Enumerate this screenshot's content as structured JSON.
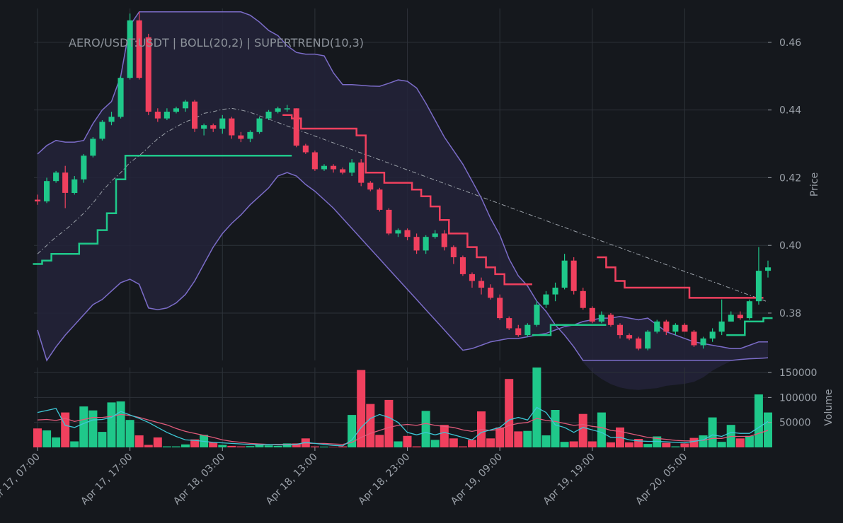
{
  "chart_data": {
    "type": "candlestick",
    "title": "AERO/USDT:USDT | BOLL(20,2) | SUPERTREND(10,3)",
    "price_axis": {
      "label": "Price",
      "ylim": [
        0.366,
        0.47
      ],
      "ticks": [
        0.38,
        0.4,
        0.42,
        0.44,
        0.46
      ],
      "tick_labels": [
        "0.38",
        "0.40",
        "0.42",
        "0.44",
        "0.46"
      ]
    },
    "volume_axis": {
      "label": "Volume",
      "ylim": [
        0,
        160000
      ],
      "ticks": [
        50000,
        100000,
        150000
      ],
      "tick_labels": [
        "50000",
        "100000",
        "150000"
      ]
    },
    "x_axis": {
      "interval_hours": 1,
      "n_bars": 80,
      "tick_indices": [
        0,
        10,
        20,
        30,
        40,
        50,
        60,
        70
      ],
      "tick_labels": [
        "Apr 17, 07:00",
        "Apr 17, 17:00",
        "Apr 18, 03:00",
        "Apr 18, 13:00",
        "Apr 18, 23:00",
        "Apr 19, 09:00",
        "Apr 19, 19:00",
        "Apr 20, 05:00"
      ]
    },
    "grid": true,
    "colors": {
      "up": "#1fc88a",
      "down": "#f0405e",
      "bollinger": "#7b6cc8",
      "bollinger_mid": "#9aa0a8",
      "volume_ma_fast": "#3dc8d6",
      "volume_ma_slow": "#e05a7a"
    },
    "candles": {
      "open": [
        0.4135,
        0.413,
        0.419,
        0.4215,
        0.4155,
        0.4195,
        0.4265,
        0.4315,
        0.4365,
        0.438,
        0.4495,
        0.4665,
        0.4615,
        0.4395,
        0.4375,
        0.4395,
        0.4405,
        0.4425,
        0.4345,
        0.4355,
        0.4345,
        0.4375,
        0.4325,
        0.4315,
        0.4335,
        0.4375,
        0.4395,
        0.4405,
        0.4405,
        0.4295,
        0.4275,
        0.4225,
        0.4235,
        0.4225,
        0.4215,
        0.4245,
        0.4185,
        0.4165,
        0.4105,
        0.4035,
        0.4045,
        0.4025,
        0.3985,
        0.4025,
        0.4035,
        0.3995,
        0.3965,
        0.3915,
        0.3895,
        0.3875,
        0.3845,
        0.3785,
        0.3755,
        0.3735,
        0.3765,
        0.3825,
        0.3855,
        0.3875,
        0.3955,
        0.3865,
        0.3815,
        0.3775,
        0.3795,
        0.3765,
        0.3735,
        0.3725,
        0.3695,
        0.3745,
        0.3775,
        0.3745,
        0.3765,
        0.3745,
        0.3705,
        0.3725,
        0.3745,
        0.3775,
        0.3795,
        0.3785,
        0.3835,
        0.3925
      ],
      "close": [
        0.413,
        0.419,
        0.4215,
        0.4155,
        0.4195,
        0.4265,
        0.4315,
        0.4365,
        0.438,
        0.4495,
        0.4665,
        0.4495,
        0.4395,
        0.4375,
        0.4395,
        0.4405,
        0.4425,
        0.4345,
        0.4355,
        0.4345,
        0.4375,
        0.4325,
        0.4315,
        0.4335,
        0.4375,
        0.4395,
        0.4405,
        0.4405,
        0.4295,
        0.4275,
        0.4225,
        0.4235,
        0.4225,
        0.4215,
        0.4245,
        0.4185,
        0.4165,
        0.4105,
        0.4035,
        0.4045,
        0.4025,
        0.3985,
        0.4025,
        0.4035,
        0.3995,
        0.3965,
        0.3915,
        0.3895,
        0.3875,
        0.3845,
        0.3785,
        0.3755,
        0.3735,
        0.3765,
        0.3825,
        0.3855,
        0.3875,
        0.3955,
        0.3865,
        0.3815,
        0.3775,
        0.3795,
        0.3765,
        0.3735,
        0.3725,
        0.3695,
        0.3745,
        0.3775,
        0.3745,
        0.3765,
        0.3745,
        0.3705,
        0.3725,
        0.3745,
        0.3775,
        0.3795,
        0.3785,
        0.3835,
        0.3925,
        0.3935
      ],
      "high": [
        0.415,
        0.42,
        0.422,
        0.4235,
        0.4205,
        0.427,
        0.432,
        0.437,
        0.4395,
        0.45,
        0.4685,
        0.469,
        0.4625,
        0.4405,
        0.4405,
        0.441,
        0.443,
        0.443,
        0.436,
        0.436,
        0.4385,
        0.438,
        0.4335,
        0.434,
        0.438,
        0.44,
        0.441,
        0.4415,
        0.4405,
        0.43,
        0.428,
        0.424,
        0.424,
        0.423,
        0.4255,
        0.4255,
        0.419,
        0.417,
        0.411,
        0.405,
        0.405,
        0.4035,
        0.403,
        0.4045,
        0.4045,
        0.4,
        0.397,
        0.392,
        0.3905,
        0.3885,
        0.3855,
        0.379,
        0.3765,
        0.377,
        0.3835,
        0.3865,
        0.389,
        0.3975,
        0.3965,
        0.3875,
        0.382,
        0.3805,
        0.38,
        0.377,
        0.374,
        0.373,
        0.375,
        0.378,
        0.378,
        0.377,
        0.377,
        0.375,
        0.373,
        0.3755,
        0.384,
        0.3805,
        0.3805,
        0.384,
        0.3995,
        0.3955
      ],
      "low": [
        0.412,
        0.4125,
        0.4185,
        0.411,
        0.415,
        0.4185,
        0.426,
        0.431,
        0.4355,
        0.4375,
        0.449,
        0.449,
        0.4385,
        0.4365,
        0.437,
        0.439,
        0.4395,
        0.4335,
        0.4325,
        0.4335,
        0.433,
        0.4315,
        0.4305,
        0.4305,
        0.433,
        0.437,
        0.439,
        0.4395,
        0.429,
        0.427,
        0.422,
        0.422,
        0.4215,
        0.421,
        0.4205,
        0.4175,
        0.416,
        0.41,
        0.403,
        0.4025,
        0.4015,
        0.3975,
        0.3975,
        0.402,
        0.3985,
        0.3945,
        0.391,
        0.3875,
        0.3855,
        0.384,
        0.378,
        0.375,
        0.373,
        0.373,
        0.376,
        0.3815,
        0.3835,
        0.387,
        0.3855,
        0.381,
        0.377,
        0.377,
        0.376,
        0.3725,
        0.372,
        0.369,
        0.369,
        0.374,
        0.3735,
        0.3735,
        0.3745,
        0.37,
        0.3695,
        0.3715,
        0.3735,
        0.3775,
        0.378,
        0.378,
        0.3825,
        0.3905
      ]
    },
    "volume": [
      38000,
      34000,
      20000,
      70000,
      12000,
      82000,
      74000,
      31000,
      90000,
      92000,
      55000,
      24000,
      5000,
      20000,
      2000,
      2000,
      6000,
      16000,
      25000,
      10000,
      5000,
      3000,
      2000,
      2500,
      6000,
      4000,
      3000,
      8000,
      8000,
      18000,
      2000,
      1500,
      1000,
      2000,
      65000,
      155000,
      87000,
      25000,
      95000,
      12000,
      23000,
      2000,
      73000,
      15000,
      45000,
      18000,
      2000,
      15000,
      72000,
      18000,
      40000,
      137000,
      32000,
      33000,
      168000,
      24000,
      75000,
      11000,
      12000,
      67000,
      12000,
      70000,
      10000,
      40000,
      10000,
      17000,
      7000,
      22000,
      9000,
      2000,
      8000,
      19000,
      24000,
      60000,
      11000,
      45000,
      18000,
      23000,
      106000,
      70000
    ],
    "bollinger_bands": {
      "upper": [
        0.427,
        0.4295,
        0.431,
        0.4305,
        0.4305,
        0.431,
        0.436,
        0.44,
        0.4425,
        0.45,
        0.465,
        0.469,
        0.469,
        0.469,
        0.469,
        0.469,
        0.469,
        0.469,
        0.469,
        0.469,
        0.469,
        0.469,
        0.469,
        0.468,
        0.466,
        0.4635,
        0.462,
        0.459,
        0.457,
        0.4565,
        0.4565,
        0.456,
        0.451,
        0.4475,
        0.4475,
        0.4473,
        0.4471,
        0.447,
        0.4479,
        0.4489,
        0.4485,
        0.4465,
        0.442,
        0.437,
        0.432,
        0.428,
        0.424,
        0.419,
        0.414,
        0.408,
        0.403,
        0.396,
        0.391,
        0.388,
        0.3835,
        0.3805,
        0.3765,
        0.3735,
        0.37,
        0.3655,
        0.3625,
        0.3605,
        0.359,
        0.358,
        0.3575,
        0.3573,
        0.3576,
        0.3578,
        0.3585,
        0.3588,
        0.3591,
        0.3597,
        0.361,
        0.363,
        0.3645,
        0.3658,
        0.3663,
        0.3665,
        0.3666,
        0.3668
      ],
      "mid": [
        0.3975,
        0.4,
        0.4025,
        0.4045,
        0.407,
        0.4095,
        0.4125,
        0.416,
        0.419,
        0.4215,
        0.4245,
        0.4265,
        0.429,
        0.4315,
        0.4335,
        0.435,
        0.4365,
        0.4375,
        0.439,
        0.4395,
        0.4402,
        0.4405,
        0.44,
        0.4393,
        0.4383,
        0.4373,
        0.4363,
        0.4353,
        0.4343,
        0.4333,
        0.4323,
        0.4313,
        0.4303,
        0.4293,
        0.4283,
        0.4273,
        0.4263,
        0.4253,
        0.4243,
        0.4233,
        0.4223,
        0.4213,
        0.4203,
        0.4193,
        0.4183,
        0.4173,
        0.4163,
        0.4153,
        0.4143,
        0.4133,
        0.4123,
        0.4113,
        0.4103,
        0.4093,
        0.4083,
        0.4073,
        0.4063,
        0.4053,
        0.4043,
        0.4033,
        0.4023,
        0.4013,
        0.4003,
        0.3993,
        0.3983,
        0.3973,
        0.3963,
        0.3953,
        0.3943,
        0.3933,
        0.3923,
        0.3913,
        0.3903,
        0.3893,
        0.3883,
        0.3873,
        0.3863,
        0.3853,
        0.3843,
        0.3833
      ],
      "lower": [
        0.375,
        0.3655,
        0.37,
        0.3735,
        0.3765,
        0.3795,
        0.3825,
        0.384,
        0.3865,
        0.389,
        0.39,
        0.3885,
        0.3815,
        0.381,
        0.3815,
        0.383,
        0.3855,
        0.3895,
        0.3945,
        0.3995,
        0.4035,
        0.4065,
        0.409,
        0.412,
        0.4145,
        0.417,
        0.4205,
        0.4215,
        0.4205,
        0.418,
        0.416,
        0.4135,
        0.411,
        0.408,
        0.405,
        0.402,
        0.399,
        0.396,
        0.393,
        0.39,
        0.387,
        0.384,
        0.381,
        0.378,
        0.375,
        0.372,
        0.369,
        0.3695,
        0.3705,
        0.3715,
        0.372,
        0.3725,
        0.3725,
        0.373,
        0.3735,
        0.374,
        0.375,
        0.376,
        0.3765,
        0.3775,
        0.378,
        0.3785,
        0.3785,
        0.379,
        0.3785,
        0.378,
        0.3785,
        0.3765,
        0.3745,
        0.3735,
        0.3725,
        0.3715,
        0.371,
        0.3705,
        0.37,
        0.3695,
        0.3695,
        0.3705,
        0.3715,
        0.3715
      ]
    },
    "supertrend": {
      "up_segments": [
        {
          "start": 0,
          "end": 27,
          "values": [
            0.3945,
            0.3955,
            0.3975,
            0.3975,
            0.3975,
            0.4005,
            0.4005,
            0.4045,
            0.4095,
            0.4195,
            0.4265,
            0.4265,
            0.4265,
            0.4265,
            0.4265,
            0.4265,
            0.4265,
            0.4265,
            0.4265,
            0.4265,
            0.4265,
            0.4265,
            0.4265,
            0.4265,
            0.4265,
            0.4265,
            0.4265,
            0.4265
          ]
        },
        {
          "start": 54,
          "end": 61,
          "values": [
            0.3735,
            0.3735,
            0.3765,
            0.3765,
            0.3765,
            0.3765,
            0.3765,
            0.3765
          ]
        },
        {
          "start": 75,
          "end": 79,
          "values": [
            0.3735,
            0.3735,
            0.3775,
            0.3775,
            0.3785
          ]
        }
      ],
      "down_segments": [
        {
          "start": 27,
          "end": 53,
          "values": [
            0.4385,
            0.4375,
            0.4345,
            0.4345,
            0.4345,
            0.4345,
            0.4345,
            0.4345,
            0.4325,
            0.4215,
            0.4215,
            0.4185,
            0.4185,
            0.4185,
            0.4165,
            0.4145,
            0.4115,
            0.4075,
            0.4035,
            0.4035,
            0.3995,
            0.3965,
            0.3935,
            0.3915,
            0.3885,
            0.3885,
            0.3885
          ]
        },
        {
          "start": 61,
          "end": 78,
          "values": [
            0.3965,
            0.3935,
            0.3895,
            0.3875,
            0.3875,
            0.3875,
            0.3875,
            0.3875,
            0.3875,
            0.3875,
            0.3845,
            0.3845,
            0.3845,
            0.3845,
            0.3845,
            0.3845,
            0.3845,
            0.3845
          ]
        }
      ]
    },
    "volume_ma": {
      "fast": [
        70000,
        74000,
        78000,
        44000,
        40000,
        48000,
        55000,
        56000,
        60000,
        72000,
        65000,
        58000,
        50000,
        40000,
        30000,
        22000,
        15000,
        14000,
        12000,
        10000,
        9000,
        8000,
        7000,
        6000,
        5000,
        6000,
        5000,
        5000,
        6000,
        10000,
        8000,
        6000,
        4000,
        3000,
        15000,
        40000,
        58000,
        66000,
        60000,
        50000,
        30000,
        25000,
        30000,
        25000,
        30000,
        25000,
        20000,
        15000,
        30000,
        35000,
        40000,
        55000,
        60000,
        55000,
        80000,
        70000,
        45000,
        40000,
        30000,
        40000,
        35000,
        30000,
        20000,
        20000,
        15000,
        13000,
        12000,
        12000,
        11000,
        10000,
        9000,
        12000,
        15000,
        25000,
        22000,
        30000,
        28000,
        28000,
        40000,
        52000
      ],
      "slow": [
        55000,
        56000,
        54000,
        58000,
        52000,
        56000,
        60000,
        60000,
        62000,
        66000,
        64000,
        60000,
        55000,
        50000,
        45000,
        38000,
        32000,
        28000,
        24000,
        20000,
        15000,
        12000,
        10000,
        8000,
        7000,
        6000,
        6000,
        6000,
        7000,
        8000,
        8000,
        8000,
        7000,
        6000,
        10000,
        20000,
        28000,
        34000,
        40000,
        44000,
        46000,
        44000,
        48000,
        44000,
        42000,
        40000,
        35000,
        32000,
        36000,
        34000,
        36000,
        44000,
        48000,
        50000,
        58000,
        54000,
        52000,
        48000,
        44000,
        46000,
        42000,
        40000,
        34000,
        32000,
        28000,
        24000,
        20000,
        18000,
        16000,
        14000,
        13000,
        13000,
        14000,
        18000,
        18000,
        22000,
        22000,
        22000,
        28000,
        34000
      ]
    }
  }
}
